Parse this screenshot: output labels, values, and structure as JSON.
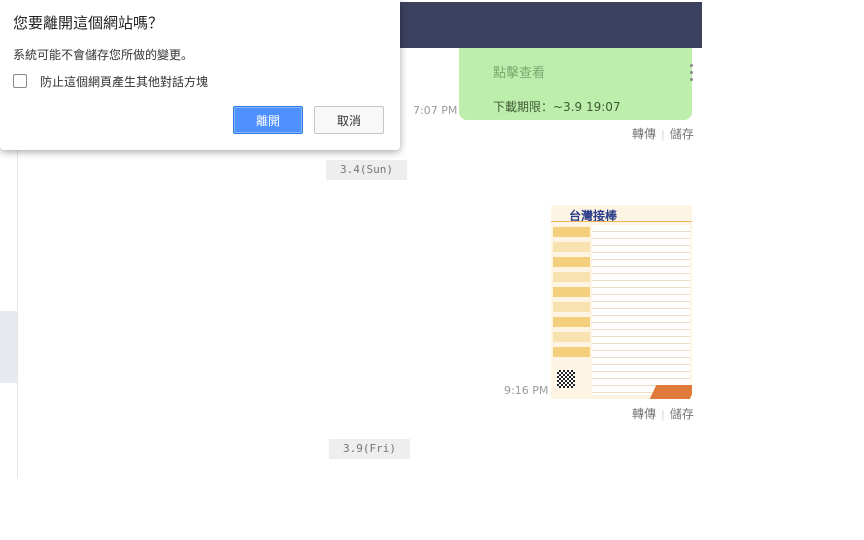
{
  "dialog": {
    "title": "您要離開這個網站嗎？",
    "message": "系統可能不會儲存您所做的變更。",
    "checkbox_label": "防止這個網頁產生其他對話方塊",
    "checkbox_checked": false,
    "leave_label": "離開",
    "cancel_label": "取消",
    "accent_color": "#4d90fe"
  },
  "chat": {
    "header_color": "#3c4160",
    "messages": [
      {
        "bubble_partial_text": "點擊查看",
        "download_text": "下載期限：~3.9 19:07",
        "time": "7:07 PM",
        "forward_label": "轉傳",
        "save_label": "儲存",
        "bubble_color": "#bdeeac"
      },
      {
        "image_title": "台灣接棒",
        "time": "9:16 PM",
        "forward_label": "轉傳",
        "save_label": "儲存"
      }
    ],
    "date_separators": [
      "3.4(Sun)",
      "3.9(Fri)"
    ]
  }
}
